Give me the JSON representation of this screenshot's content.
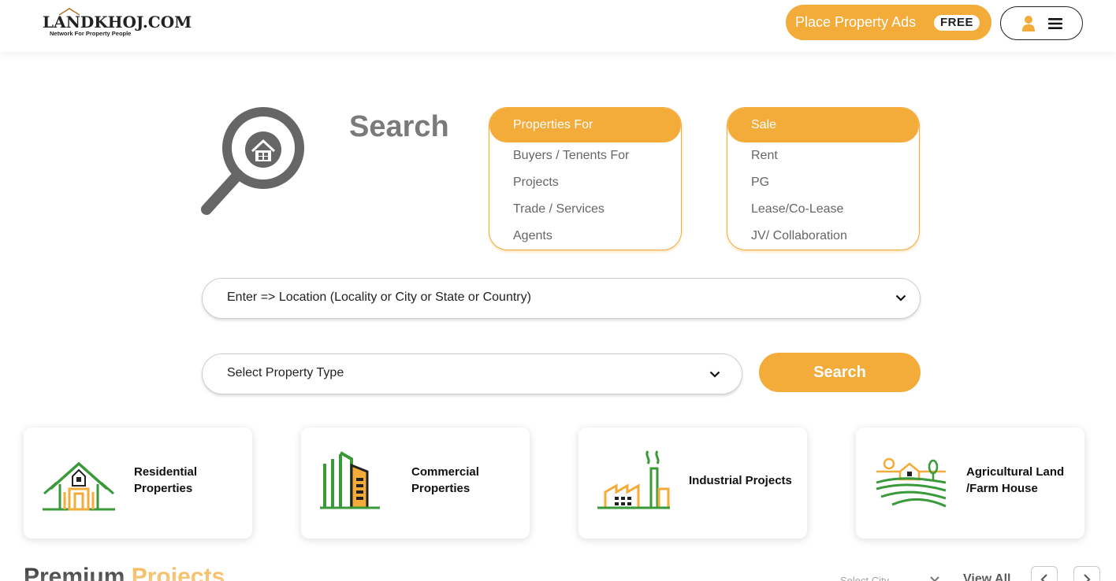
{
  "header": {
    "logo_text": "LANDKHOJ.COM",
    "logo_tagline": "Network For Property People",
    "place_ads_label": "Place Property Ads",
    "free_badge": "FREE",
    "user_icon": "user-icon",
    "menu_icon": "hamburger-menu-icon"
  },
  "search": {
    "heading": "Search",
    "illustration": "magnifier-house-icon",
    "properties_for": {
      "header": "Properties For",
      "items": [
        "Buyers / Tenents For",
        "Projects",
        "Trade / Services",
        "Agents"
      ]
    },
    "transaction": {
      "header": "Sale",
      "items": [
        "Rent",
        "PG",
        "Lease/Co-Lease",
        "JV/ Collaboration"
      ]
    },
    "location_placeholder": "Enter => Location (Locality or City or State or Country)",
    "property_type_placeholder": "Select Property Type",
    "search_button": "Search"
  },
  "categories": [
    {
      "label_line1": "Residential",
      "label_line2": "Properties",
      "icon": "house-icon"
    },
    {
      "label_line1": "Commercial",
      "label_line2": "Properties",
      "icon": "office-building-icon"
    },
    {
      "label_line1": "Industrial Projects",
      "label_line2": "",
      "icon": "factory-icon"
    },
    {
      "label_line1": "Agricultural Land",
      "label_line2": "/Farm House",
      "icon": "farm-field-icon"
    }
  ],
  "premium": {
    "title": "Premium",
    "title_accent": "Projects",
    "city_select": "Select City",
    "view_all": "View All"
  },
  "colors": {
    "accent": "#f3ab3a",
    "green": "#3a9a3a",
    "heading_gray": "#7a7a7a"
  }
}
